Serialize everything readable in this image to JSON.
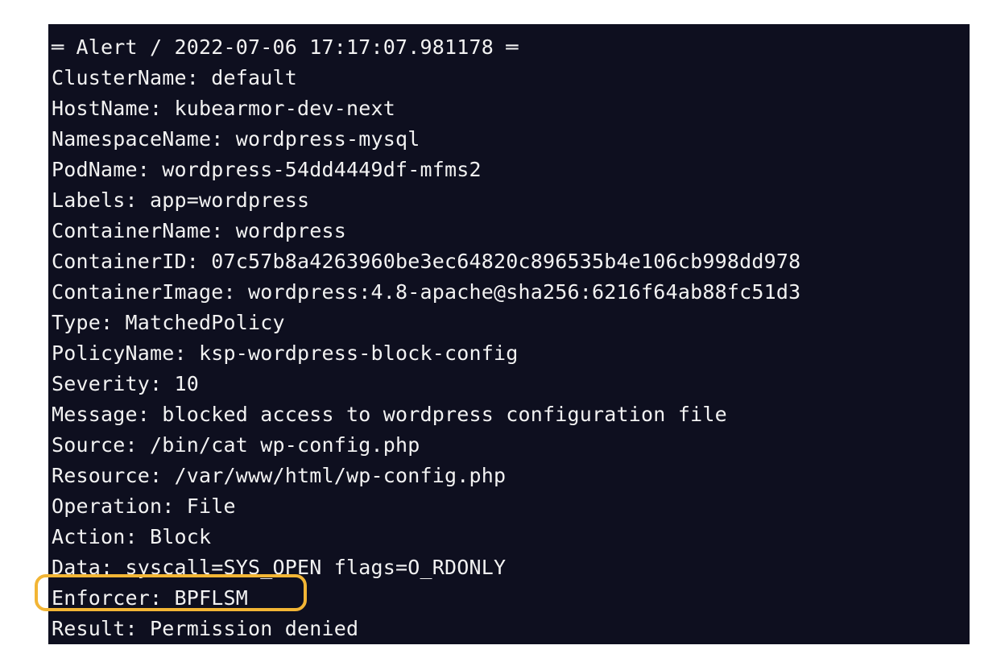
{
  "terminal": {
    "lines": [
      "═ Alert / 2022-07-06 17:17:07.981178 ═",
      "ClusterName: default",
      "HostName: kubearmor-dev-next",
      "NamespaceName: wordpress-mysql",
      "PodName: wordpress-54dd4449df-mfms2",
      "Labels: app=wordpress",
      "ContainerName: wordpress",
      "ContainerID: 07c57b8a4263960be3ec64820c896535b4e106cb998dd978",
      "ContainerImage: wordpress:4.8-apache@sha256:6216f64ab88fc51d3",
      "Type: MatchedPolicy",
      "PolicyName: ksp-wordpress-block-config",
      "Severity: 10",
      "Message: blocked access to wordpress configuration file",
      "Source: /bin/cat wp-config.php",
      "Resource: /var/www/html/wp-config.php",
      "Operation: File",
      "Action: Block",
      "Data: syscall=SYS_OPEN flags=O_RDONLY",
      "Enforcer: BPFLSM",
      "Result: Permission denied"
    ],
    "highlighted_line": "Enforcer: BPFLSM",
    "colors": {
      "background": "#0e0f1f",
      "text": "#f2f2f2",
      "highlight_border": "#f2b535"
    }
  }
}
